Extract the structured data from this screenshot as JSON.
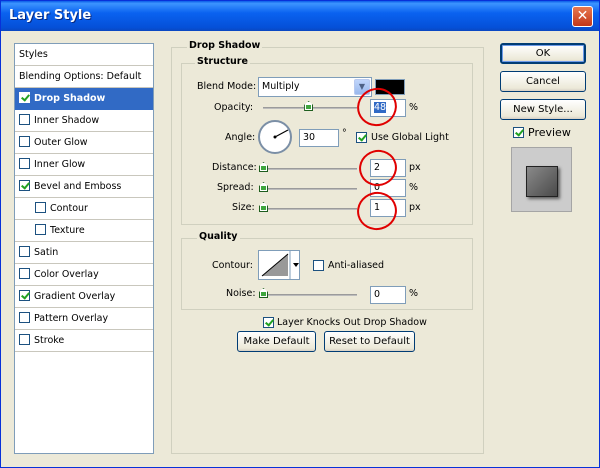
{
  "window": {
    "title": "Layer Style",
    "close_glyph": "✕"
  },
  "styles_panel": {
    "items": [
      {
        "label": "Styles",
        "checkbox": false,
        "checked": false,
        "selected": false
      },
      {
        "label": "Blending Options: Default",
        "checkbox": false,
        "checked": false,
        "selected": false
      },
      {
        "label": "Drop Shadow",
        "checkbox": true,
        "checked": true,
        "selected": true
      },
      {
        "label": "Inner Shadow",
        "checkbox": true,
        "checked": false,
        "selected": false
      },
      {
        "label": "Outer Glow",
        "checkbox": true,
        "checked": false,
        "selected": false
      },
      {
        "label": "Inner Glow",
        "checkbox": true,
        "checked": false,
        "selected": false
      },
      {
        "label": "Bevel and Emboss",
        "checkbox": true,
        "checked": true,
        "selected": false
      },
      {
        "label": "Contour",
        "checkbox": true,
        "checked": false,
        "selected": false,
        "indent": true
      },
      {
        "label": "Texture",
        "checkbox": true,
        "checked": false,
        "selected": false,
        "indent": true
      },
      {
        "label": "Satin",
        "checkbox": true,
        "checked": false,
        "selected": false
      },
      {
        "label": "Color Overlay",
        "checkbox": true,
        "checked": false,
        "selected": false
      },
      {
        "label": "Gradient Overlay",
        "checkbox": true,
        "checked": true,
        "selected": false
      },
      {
        "label": "Pattern Overlay",
        "checkbox": true,
        "checked": false,
        "selected": false
      },
      {
        "label": "Stroke",
        "checkbox": true,
        "checked": false,
        "selected": false
      }
    ]
  },
  "drop_shadow": {
    "title": "Drop Shadow",
    "structure": {
      "title": "Structure",
      "blend_mode_label": "Blend Mode:",
      "blend_mode_value": "Multiply",
      "shadow_color": "#000000",
      "opacity_label": "Opacity:",
      "opacity_value": "48",
      "opacity_unit": "%",
      "opacity_fraction": 0.48,
      "angle_label": "Angle:",
      "angle_value": "30",
      "angle_unit": "°",
      "use_global_light_label": "Use Global Light",
      "use_global_light_checked": true,
      "distance_label": "Distance:",
      "distance_value": "2",
      "distance_unit": "px",
      "spread_label": "Spread:",
      "spread_value": "0",
      "spread_unit": "%",
      "size_label": "Size:",
      "size_value": "1",
      "size_unit": "px"
    },
    "quality": {
      "title": "Quality",
      "contour_label": "Contour:",
      "anti_aliased_label": "Anti-aliased",
      "anti_aliased_checked": false,
      "noise_label": "Noise:",
      "noise_value": "0",
      "noise_unit": "%"
    },
    "knockout_label": "Layer Knocks Out Drop Shadow",
    "knockout_checked": true,
    "make_default_label": "Make Default",
    "reset_default_label": "Reset to Default"
  },
  "buttons": {
    "ok": "OK",
    "cancel": "Cancel",
    "new_style": "New Style...",
    "preview_label": "Preview",
    "preview_checked": true
  },
  "colors": {
    "title_bar": "#0a5de8",
    "selection": "#316ac5",
    "annotation": "#e00000"
  }
}
